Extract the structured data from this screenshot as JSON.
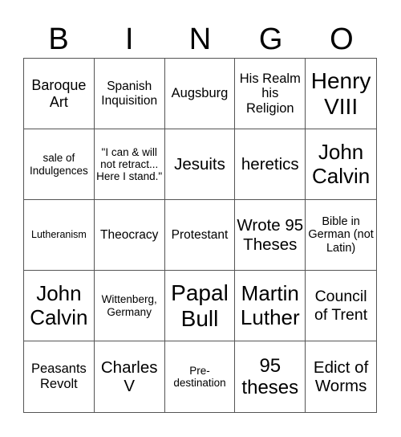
{
  "header": {
    "letters": [
      "B",
      "I",
      "N",
      "G",
      "O"
    ]
  },
  "board": {
    "cells": [
      "Baroque Art",
      "Spanish Inquisition",
      "Augsburg",
      "His Realm his Religion",
      "Henry VIII",
      "sale of Indulgences",
      "\"I can & will not retract... Here I stand.\"",
      "Jesuits",
      "heretics",
      "John Calvin",
      "Lutheranism",
      "Theocracy",
      "Protestant",
      "Wrote 95 Theses",
      "Bible in German (not Latin)",
      "John Calvin",
      "Wittenberg, Germany",
      "Papal Bull",
      "Martin Luther",
      "Council of Trent",
      "Peasants Revolt",
      "Charles V",
      "Pre-destination",
      "95 theses",
      "Edict of Worms"
    ]
  }
}
